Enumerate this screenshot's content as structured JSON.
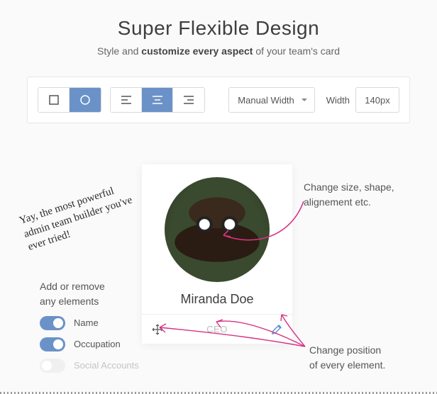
{
  "heading": "Super Flexible Design",
  "subheading_pre": "Style and ",
  "subheading_bold": "customize every aspect",
  "subheading_post": " of your team's card",
  "toolbar": {
    "mode_label": "Manual Width",
    "width_label": "Width",
    "width_value": "140px"
  },
  "card": {
    "name": "Miranda Doe",
    "role": "CEO"
  },
  "annot": {
    "hand": "Yay, the most powerful admin team builder you've ever tried!",
    "right1": "Change size, shape, alignement etc.",
    "left_title_1": "Add or remove",
    "left_title_2": "any elements",
    "right2_1": "Change position",
    "right2_2": "of every element."
  },
  "toggles": {
    "name": "Name",
    "occupation": "Occupation",
    "social": "Social Accounts"
  }
}
